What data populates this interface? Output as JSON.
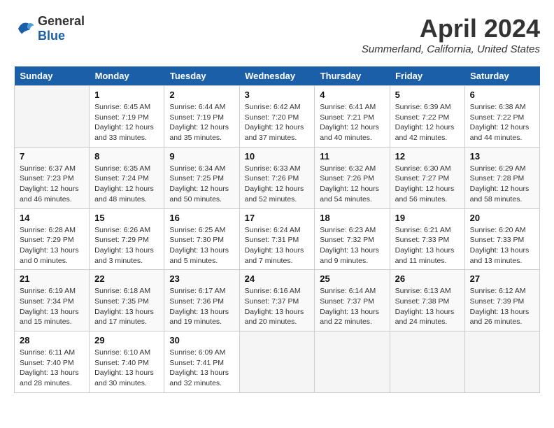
{
  "header": {
    "logo_general": "General",
    "logo_blue": "Blue",
    "month_title": "April 2024",
    "location": "Summerland, California, United States"
  },
  "days_of_week": [
    "Sunday",
    "Monday",
    "Tuesday",
    "Wednesday",
    "Thursday",
    "Friday",
    "Saturday"
  ],
  "weeks": [
    [
      {
        "num": "",
        "sunrise": "",
        "sunset": "",
        "daylight": ""
      },
      {
        "num": "1",
        "sunrise": "Sunrise: 6:45 AM",
        "sunset": "Sunset: 7:19 PM",
        "daylight": "Daylight: 12 hours and 33 minutes."
      },
      {
        "num": "2",
        "sunrise": "Sunrise: 6:44 AM",
        "sunset": "Sunset: 7:19 PM",
        "daylight": "Daylight: 12 hours and 35 minutes."
      },
      {
        "num": "3",
        "sunrise": "Sunrise: 6:42 AM",
        "sunset": "Sunset: 7:20 PM",
        "daylight": "Daylight: 12 hours and 37 minutes."
      },
      {
        "num": "4",
        "sunrise": "Sunrise: 6:41 AM",
        "sunset": "Sunset: 7:21 PM",
        "daylight": "Daylight: 12 hours and 40 minutes."
      },
      {
        "num": "5",
        "sunrise": "Sunrise: 6:39 AM",
        "sunset": "Sunset: 7:22 PM",
        "daylight": "Daylight: 12 hours and 42 minutes."
      },
      {
        "num": "6",
        "sunrise": "Sunrise: 6:38 AM",
        "sunset": "Sunset: 7:22 PM",
        "daylight": "Daylight: 12 hours and 44 minutes."
      }
    ],
    [
      {
        "num": "7",
        "sunrise": "Sunrise: 6:37 AM",
        "sunset": "Sunset: 7:23 PM",
        "daylight": "Daylight: 12 hours and 46 minutes."
      },
      {
        "num": "8",
        "sunrise": "Sunrise: 6:35 AM",
        "sunset": "Sunset: 7:24 PM",
        "daylight": "Daylight: 12 hours and 48 minutes."
      },
      {
        "num": "9",
        "sunrise": "Sunrise: 6:34 AM",
        "sunset": "Sunset: 7:25 PM",
        "daylight": "Daylight: 12 hours and 50 minutes."
      },
      {
        "num": "10",
        "sunrise": "Sunrise: 6:33 AM",
        "sunset": "Sunset: 7:26 PM",
        "daylight": "Daylight: 12 hours and 52 minutes."
      },
      {
        "num": "11",
        "sunrise": "Sunrise: 6:32 AM",
        "sunset": "Sunset: 7:26 PM",
        "daylight": "Daylight: 12 hours and 54 minutes."
      },
      {
        "num": "12",
        "sunrise": "Sunrise: 6:30 AM",
        "sunset": "Sunset: 7:27 PM",
        "daylight": "Daylight: 12 hours and 56 minutes."
      },
      {
        "num": "13",
        "sunrise": "Sunrise: 6:29 AM",
        "sunset": "Sunset: 7:28 PM",
        "daylight": "Daylight: 12 hours and 58 minutes."
      }
    ],
    [
      {
        "num": "14",
        "sunrise": "Sunrise: 6:28 AM",
        "sunset": "Sunset: 7:29 PM",
        "daylight": "Daylight: 13 hours and 0 minutes."
      },
      {
        "num": "15",
        "sunrise": "Sunrise: 6:26 AM",
        "sunset": "Sunset: 7:29 PM",
        "daylight": "Daylight: 13 hours and 3 minutes."
      },
      {
        "num": "16",
        "sunrise": "Sunrise: 6:25 AM",
        "sunset": "Sunset: 7:30 PM",
        "daylight": "Daylight: 13 hours and 5 minutes."
      },
      {
        "num": "17",
        "sunrise": "Sunrise: 6:24 AM",
        "sunset": "Sunset: 7:31 PM",
        "daylight": "Daylight: 13 hours and 7 minutes."
      },
      {
        "num": "18",
        "sunrise": "Sunrise: 6:23 AM",
        "sunset": "Sunset: 7:32 PM",
        "daylight": "Daylight: 13 hours and 9 minutes."
      },
      {
        "num": "19",
        "sunrise": "Sunrise: 6:21 AM",
        "sunset": "Sunset: 7:33 PM",
        "daylight": "Daylight: 13 hours and 11 minutes."
      },
      {
        "num": "20",
        "sunrise": "Sunrise: 6:20 AM",
        "sunset": "Sunset: 7:33 PM",
        "daylight": "Daylight: 13 hours and 13 minutes."
      }
    ],
    [
      {
        "num": "21",
        "sunrise": "Sunrise: 6:19 AM",
        "sunset": "Sunset: 7:34 PM",
        "daylight": "Daylight: 13 hours and 15 minutes."
      },
      {
        "num": "22",
        "sunrise": "Sunrise: 6:18 AM",
        "sunset": "Sunset: 7:35 PM",
        "daylight": "Daylight: 13 hours and 17 minutes."
      },
      {
        "num": "23",
        "sunrise": "Sunrise: 6:17 AM",
        "sunset": "Sunset: 7:36 PM",
        "daylight": "Daylight: 13 hours and 19 minutes."
      },
      {
        "num": "24",
        "sunrise": "Sunrise: 6:16 AM",
        "sunset": "Sunset: 7:37 PM",
        "daylight": "Daylight: 13 hours and 20 minutes."
      },
      {
        "num": "25",
        "sunrise": "Sunrise: 6:14 AM",
        "sunset": "Sunset: 7:37 PM",
        "daylight": "Daylight: 13 hours and 22 minutes."
      },
      {
        "num": "26",
        "sunrise": "Sunrise: 6:13 AM",
        "sunset": "Sunset: 7:38 PM",
        "daylight": "Daylight: 13 hours and 24 minutes."
      },
      {
        "num": "27",
        "sunrise": "Sunrise: 6:12 AM",
        "sunset": "Sunset: 7:39 PM",
        "daylight": "Daylight: 13 hours and 26 minutes."
      }
    ],
    [
      {
        "num": "28",
        "sunrise": "Sunrise: 6:11 AM",
        "sunset": "Sunset: 7:40 PM",
        "daylight": "Daylight: 13 hours and 28 minutes."
      },
      {
        "num": "29",
        "sunrise": "Sunrise: 6:10 AM",
        "sunset": "Sunset: 7:40 PM",
        "daylight": "Daylight: 13 hours and 30 minutes."
      },
      {
        "num": "30",
        "sunrise": "Sunrise: 6:09 AM",
        "sunset": "Sunset: 7:41 PM",
        "daylight": "Daylight: 13 hours and 32 minutes."
      },
      {
        "num": "",
        "sunrise": "",
        "sunset": "",
        "daylight": ""
      },
      {
        "num": "",
        "sunrise": "",
        "sunset": "",
        "daylight": ""
      },
      {
        "num": "",
        "sunrise": "",
        "sunset": "",
        "daylight": ""
      },
      {
        "num": "",
        "sunrise": "",
        "sunset": "",
        "daylight": ""
      }
    ]
  ]
}
